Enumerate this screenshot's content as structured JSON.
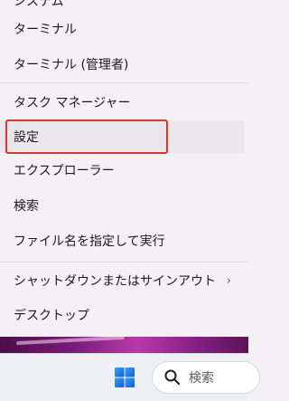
{
  "menu": {
    "cut_off_top_label": "システム",
    "items": [
      {
        "label": "ターミナル"
      },
      {
        "label": "ターミナル (管理者)"
      },
      {
        "label": "タスク マネージャー"
      },
      {
        "label": "設定"
      },
      {
        "label": "エクスプローラー"
      },
      {
        "label": "検索"
      },
      {
        "label": "ファイル名を指定して実行"
      },
      {
        "label": "シャットダウンまたはサインアウト"
      },
      {
        "label": "デスクトップ"
      }
    ],
    "submenu_chevron": "›"
  },
  "taskbar": {
    "search_placeholder": "検索"
  },
  "colors": {
    "highlight_border": "#e13232",
    "start_blue": "#1a73e8"
  }
}
